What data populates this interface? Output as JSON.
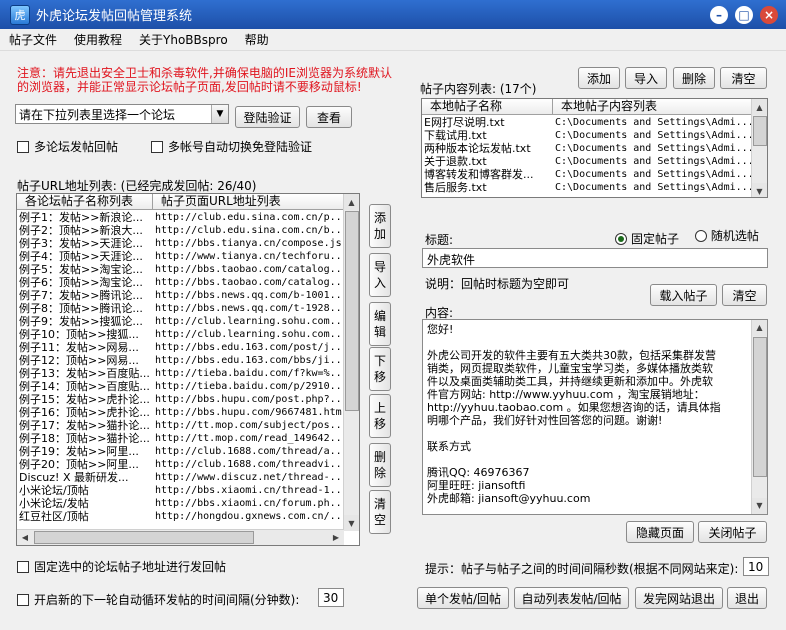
{
  "window": {
    "title": "外虎论坛发帖回帖管理系统"
  },
  "menu": [
    "帖子文件",
    "使用教程",
    "关于YhoBBspro",
    "帮助"
  ],
  "notice": [
    "注意：请先退出安全卫士和杀毒软件,并确保电脑的IE浏览器为系统默认",
    "的浏览器，并能正常显示论坛帖子页面,发回帖时请不要移动鼠标!"
  ],
  "forum_select": {
    "value": "请在下拉列表里选择一个论坛"
  },
  "buttons": {
    "login_verify": "登陆验证",
    "view": "查看",
    "add": "添加",
    "import": "导入",
    "delete": "删除",
    "clear": "清空",
    "load_post": "载入帖子",
    "clear2": "清空",
    "hide_page": "隐藏页面",
    "close_post": "关闭帖子",
    "single_post": "单个发帖/回帖",
    "auto_list": "自动列表发帖/回帖",
    "finish_exit": "发完网站退出",
    "exit": "退出"
  },
  "side_buttons": [
    "添加",
    "导入",
    "编辑",
    "下移",
    "上移",
    "删除",
    "清空"
  ],
  "options": {
    "multi_forum": "多论坛发帖回帖",
    "multi_account": "多帐号自动切换免登陆验证",
    "fixed_url": "固定选中的论坛帖子地址进行发回帖",
    "auto_loop": "开启新的下一轮自动循环发帖的时间间隔(分钟数):",
    "auto_loop_value": "30"
  },
  "url_list": {
    "title": "帖子URL地址列表: (已经完成发回帖: 26/40)",
    "columns": [
      "各论坛帖子名称列表",
      "帖子页面URL地址列表"
    ],
    "rows": [
      [
        "例子1：发帖>>新浪论...",
        "http://club.edu.sina.com.cn/p..."
      ],
      [
        "例子2：顶帖>>新浪大...",
        "http://club.edu.sina.com.cn/b..."
      ],
      [
        "例子3：发帖>>天涯论...",
        "http://bbs.tianya.cn/compose.js"
      ],
      [
        "例子4：顶帖>>天涯论...",
        "http://www.tianya.cn/techforu..."
      ],
      [
        "例子5：发帖>>淘宝论...",
        "http://bbs.taobao.com/catalog..."
      ],
      [
        "例子6：顶帖>>淘宝论...",
        "http://bbs.taobao.com/catalog..."
      ],
      [
        "例子7：发帖>>腾讯论...",
        "http://bbs.news.qq.com/b-1001..."
      ],
      [
        "例子8：顶帖>>腾讯论...",
        "http://bbs.news.qq.com/t-1928..."
      ],
      [
        "例子9：发帖>>搜狐论...",
        "http://club.learning.sohu.com..."
      ],
      [
        "例子10：顶帖>>搜狐...",
        "http://club.learning.sohu.com..."
      ],
      [
        "例子11：发帖>>网易...",
        "http://bbs.edu.163.com/post/j..."
      ],
      [
        "例子12：顶帖>>网易...",
        "http://bbs.edu.163.com/bbs/ji..."
      ],
      [
        "例子13：发帖>>百度贴...",
        "http://tieba.baidu.com/f?kw=%..."
      ],
      [
        "例子14：顶帖>>百度贴...",
        "http://tieba.baidu.com/p/2910..."
      ],
      [
        "例子15：发帖>>虎扑论...",
        "http://bbs.hupu.com/post.php?..."
      ],
      [
        "例子16：顶帖>>虎扑论...",
        "http://bbs.hupu.com/9667481.htm"
      ],
      [
        "例子17：发帖>>猫扑论...",
        "http://tt.mop.com/subject/pos..."
      ],
      [
        "例子18：顶帖>>猫扑论...",
        "http://tt.mop.com/read_149642..."
      ],
      [
        "例子19：发帖>>阿里...",
        "http://club.1688.com/thread/a..."
      ],
      [
        "例子20：顶帖>>阿里...",
        "http://club.1688.com/threadvi..."
      ],
      [
        "Discuz! X 最新研发...",
        "http://www.discuz.net/thread-..."
      ],
      [
        "小米论坛/顶帖",
        "http://bbs.xiaomi.cn/thread-1..."
      ],
      [
        "小米论坛/发帖",
        "http://bbs.xiaomi.cn/forum.ph..."
      ],
      [
        "红豆社区/顶帖",
        "http://hongdou.gxnews.com.cn/..."
      ]
    ]
  },
  "content_list": {
    "title": "帖子内容列表: (17个)",
    "columns": [
      "本地帖子名称",
      "本地帖子内容列表"
    ],
    "rows": [
      [
        "E网打尽说明.txt",
        "C:\\Documents and Settings\\Admi..."
      ],
      [
        "下载试用.txt",
        "C:\\Documents and Settings\\Admi..."
      ],
      [
        "两种版本论坛发帖.txt",
        "C:\\Documents and Settings\\Admi..."
      ],
      [
        "关于退款.txt",
        "C:\\Documents and Settings\\Admi..."
      ],
      [
        "博客转发和博客群发...",
        "C:\\Documents and Settings\\Admi..."
      ],
      [
        "售后服务.txt",
        "C:\\Documents and Settings\\Admi..."
      ]
    ]
  },
  "post": {
    "title_label": "标题:",
    "radio_fixed": "固定帖子",
    "radio_random": "随机选帖",
    "title_value": "外虎软件",
    "note": "说明：回帖时标题为空即可",
    "content_label": "内容:",
    "content_lines": [
      "您好!",
      "",
      "外虎公司开发的软件主要有五大类共30款，包括采集群发营",
      "销类，网页提取类软件，儿童宝宝学习类，多媒体播放类软",
      "件以及桌面类辅助类工具，并持继续更新和添加中。外虎软",
      "件官方网站: http://www.yyhuu.com ，淘宝展销地址：",
      "http://yyhuu.taobao.com 。如果您想咨询的话，请具体指",
      "明哪个产品，我们好针对性回答您的问题。谢谢!",
      "",
      "联系方式",
      "",
      "腾讯QQ: 46976367",
      "阿里旺旺: jiansoftfi",
      "外虎邮箱: jiansoft@yyhuu.com"
    ]
  },
  "interval": {
    "label": "提示：帖子与帖子之间的时间间隔秒数(根据不同网站来定):",
    "value": "10"
  }
}
